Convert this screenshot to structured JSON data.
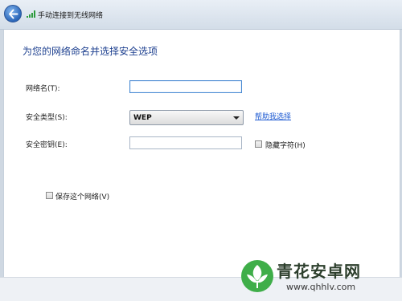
{
  "window": {
    "title": "手动连接到无线网络"
  },
  "form": {
    "heading": "为您的网络命名并选择安全选项",
    "network_name": {
      "label": "网络名(T):",
      "value": ""
    },
    "security_type": {
      "label": "安全类型(S):",
      "selected": "WEP",
      "help_link": "帮助我选择"
    },
    "security_key": {
      "label": "安全密钥(E):",
      "value": ""
    },
    "hide_chars": {
      "label": "隐藏字符(H)",
      "checked": false
    },
    "save_network": {
      "label": "保存这个网络(V)",
      "checked": false
    }
  },
  "watermark": {
    "name": "青花安卓网",
    "url": "www.qhhlv.com"
  },
  "colors": {
    "heading": "#1c3f8f",
    "link": "#1e5bd2",
    "titlebar": "#dfe7f0"
  },
  "icons": {
    "back": "back-arrow-icon",
    "signal": "wireless-signal-icon",
    "logo": "qinghua-logo-icon"
  }
}
